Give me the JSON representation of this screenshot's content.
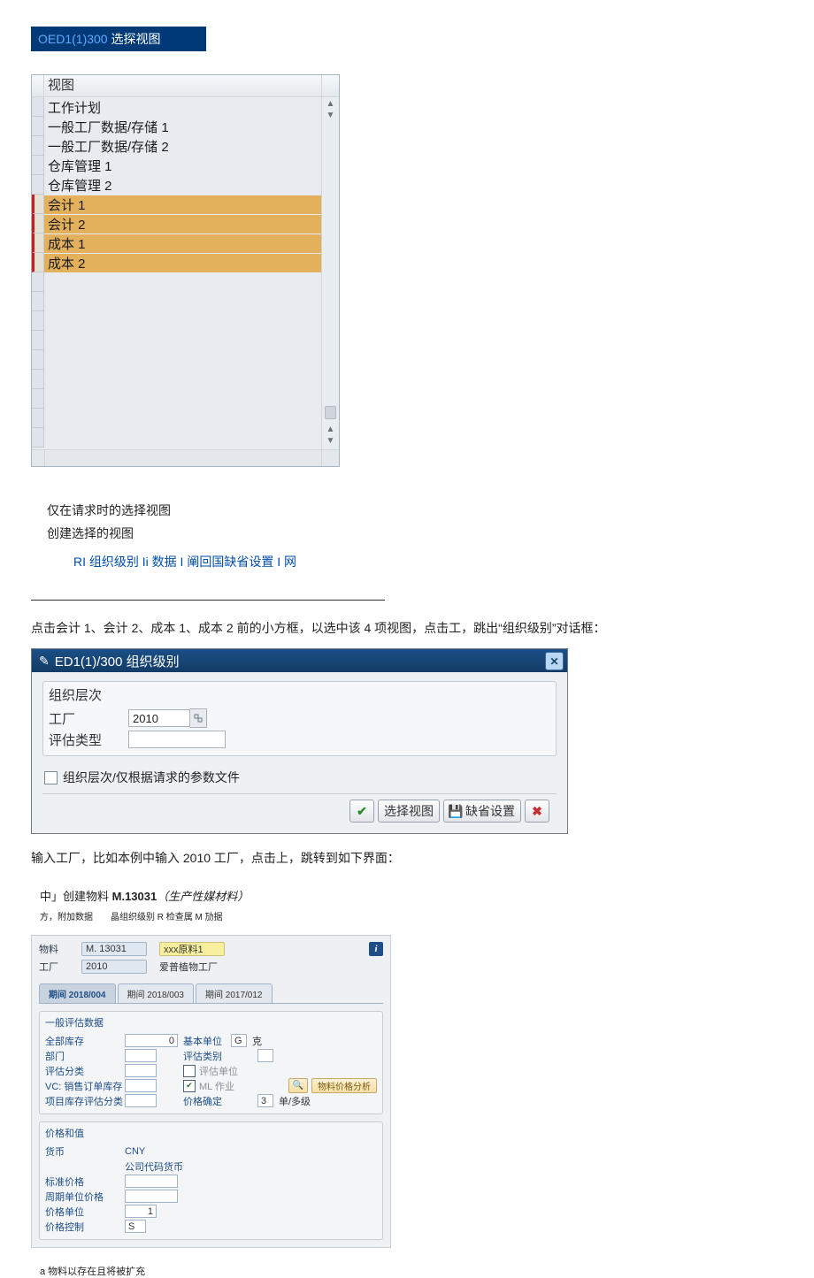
{
  "panel1": {
    "title_prefix": "OED1(1)300",
    "title_suffix": " 选探视图",
    "header": "视图",
    "items": [
      {
        "label": "工作计划",
        "selected": false
      },
      {
        "label": "一般工厂数据/存储 1",
        "selected": false
      },
      {
        "label": "一般工厂数据/存储 2",
        "selected": false
      },
      {
        "label": "仓库管理 1",
        "selected": false
      },
      {
        "label": "仓库管理 2",
        "selected": false
      },
      {
        "label": "会计 1",
        "selected": true
      },
      {
        "label": "会计 2",
        "selected": true
      },
      {
        "label": "成本 1",
        "selected": true
      },
      {
        "label": "成本 2",
        "selected": true
      }
    ],
    "opt1": "仅在请求时的选择视图",
    "opt2": "创建选择的视图",
    "linkrow": "RI 组织级别 Ii 数据 I 阐回国缺省设置 I 网"
  },
  "para1": "点击会计 1、会计 2、成本 1、成本 2 前的小方框，以选中该 4 项视图，点击工，跳出“组织级别”对话框：",
  "panel2": {
    "title": "ED1(1)/300 组织级别",
    "box_title": "组织层次",
    "row_plant_label": "工厂",
    "row_plant_value": "2010",
    "row_valtype_label": "评估类型",
    "row_valtype_value": "",
    "checkbox_label": "组织层次/仅根据请求的参数文件",
    "btn_select": "选择视图",
    "btn_default": "缺省设置"
  },
  "para2": "输入工厂，比如本例中输入 2010 工厂，点击上，跳转到如下界面：",
  "panel3": {
    "caption_pre": "中」创建物料 ",
    "caption_code": "M.13031",
    "caption_post": "（生产性媒材料）",
    "caption2": "方，附加数据　　晶组织级别 R 检查属 M 劢据",
    "hdr_mat_label": "物料",
    "hdr_mat_value": "M. 13031",
    "hdr_mat_desc": "xxx原料1",
    "hdr_plant_label": "工厂",
    "hdr_plant_value": "2010",
    "hdr_plant_desc": "爱普植物工厂",
    "tabs": [
      "期间 2018/004",
      "期间 2018/003",
      "期间 2017/012"
    ],
    "tab_active": 0,
    "group1": {
      "title": "一般评估数据",
      "rows": {
        "total_stock_label": "全部库存",
        "total_stock_value": "0",
        "base_unit_label": "基本单位",
        "base_unit_value": "G",
        "base_unit_text": "克",
        "dept_label": "部门",
        "dept_value": "",
        "val_cat_label": "评估类别",
        "val_cat_value": "",
        "val_class_label": "评估分类",
        "val_class_value": "",
        "val_unit_chk_label": "评估单位",
        "vc_label": "VC: 销售订单库存",
        "vc_value": "",
        "ml_chk_label": "ML 作业",
        "analyze_btn": "物料价格分析",
        "proj_label": "项目库存评估分类",
        "proj_value": "",
        "price_det_label": "价格确定",
        "price_det_value": "3",
        "price_det_text": "单/多级"
      }
    },
    "group2": {
      "title": "价格和值",
      "rows": {
        "curr_label": "货币",
        "curr_value": "CNY",
        "curr_text": "公司代码货币",
        "std_price_label": "标准价格",
        "std_price_value": "",
        "per_price_label": "周期单位价格",
        "per_price_value": "",
        "price_unit_label": "价格单位",
        "price_unit_value": "1",
        "price_ctrl_label": "价格控制",
        "price_ctrl_value": "S"
      }
    }
  },
  "footer_note": "a 物料以存在且将被扩充"
}
